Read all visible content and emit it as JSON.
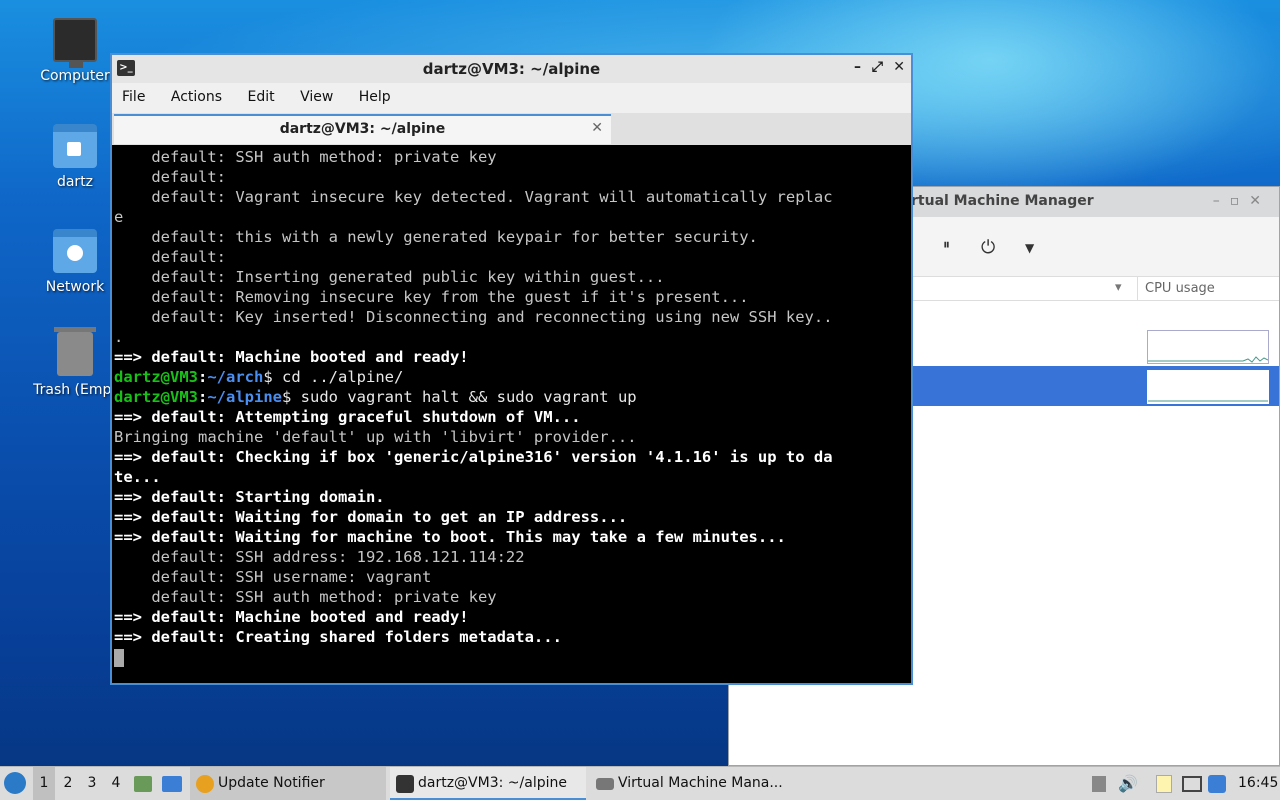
{
  "desktop": {
    "icons": [
      {
        "label": "Computer"
      },
      {
        "label": "dartz"
      },
      {
        "label": "Network"
      },
      {
        "label": "Trash (Empt"
      }
    ]
  },
  "vmm": {
    "title": "rtual Machine Manager",
    "cpu_usage_label": "CPU usage"
  },
  "terminal": {
    "title": "dartz@VM3: ~/alpine",
    "menu": [
      "File",
      "Actions",
      "Edit",
      "View",
      "Help"
    ],
    "tab_label": "dartz@VM3: ~/alpine",
    "lines": [
      {
        "s": "n",
        "t": "    default: SSH auth method: private key"
      },
      {
        "s": "n",
        "t": "    default:"
      },
      {
        "s": "n",
        "t": "    default: Vagrant insecure key detected. Vagrant will automatically replac"
      },
      {
        "s": "n",
        "t": "e"
      },
      {
        "s": "n",
        "t": "    default: this with a newly generated keypair for better security."
      },
      {
        "s": "n",
        "t": "    default:"
      },
      {
        "s": "n",
        "t": "    default: Inserting generated public key within guest..."
      },
      {
        "s": "n",
        "t": "    default: Removing insecure key from the guest if it's present..."
      },
      {
        "s": "n",
        "t": "    default: Key inserted! Disconnecting and reconnecting using new SSH key.."
      },
      {
        "s": "n",
        "t": "."
      },
      {
        "s": "b",
        "t": "==> default: Machine booted and ready!"
      },
      {
        "s": "p",
        "user": "dartz@VM3",
        "path": "~/arch",
        "cmd": "$ cd ../alpine/"
      },
      {
        "s": "p",
        "user": "dartz@VM3",
        "path": "~/alpine",
        "cmd": "$ sudo vagrant halt && sudo vagrant up"
      },
      {
        "s": "b",
        "t": "==> default: Attempting graceful shutdown of VM..."
      },
      {
        "s": "n",
        "t": "Bringing machine 'default' up with 'libvirt' provider..."
      },
      {
        "s": "b",
        "t": "==> default: Checking if box 'generic/alpine316' version '4.1.16' is up to da"
      },
      {
        "s": "b",
        "t": "te..."
      },
      {
        "s": "b",
        "t": "==> default: Starting domain."
      },
      {
        "s": "b",
        "t": "==> default: Waiting for domain to get an IP address..."
      },
      {
        "s": "b",
        "t": "==> default: Waiting for machine to boot. This may take a few minutes..."
      },
      {
        "s": "n",
        "t": "    default: SSH address: 192.168.121.114:22"
      },
      {
        "s": "n",
        "t": "    default: SSH username: vagrant"
      },
      {
        "s": "n",
        "t": "    default: SSH auth method: private key"
      },
      {
        "s": "b",
        "t": "==> default: Machine booted and ready!"
      },
      {
        "s": "b",
        "t": "==> default: Creating shared folders metadata..."
      }
    ]
  },
  "taskbar": {
    "workspaces": [
      "1",
      "2",
      "3",
      "4"
    ],
    "tasks": [
      {
        "label": "Update Notifier"
      },
      {
        "label": "dartz@VM3: ~/alpine"
      },
      {
        "label": "Virtual Machine Mana..."
      }
    ],
    "clock": "16:45"
  }
}
